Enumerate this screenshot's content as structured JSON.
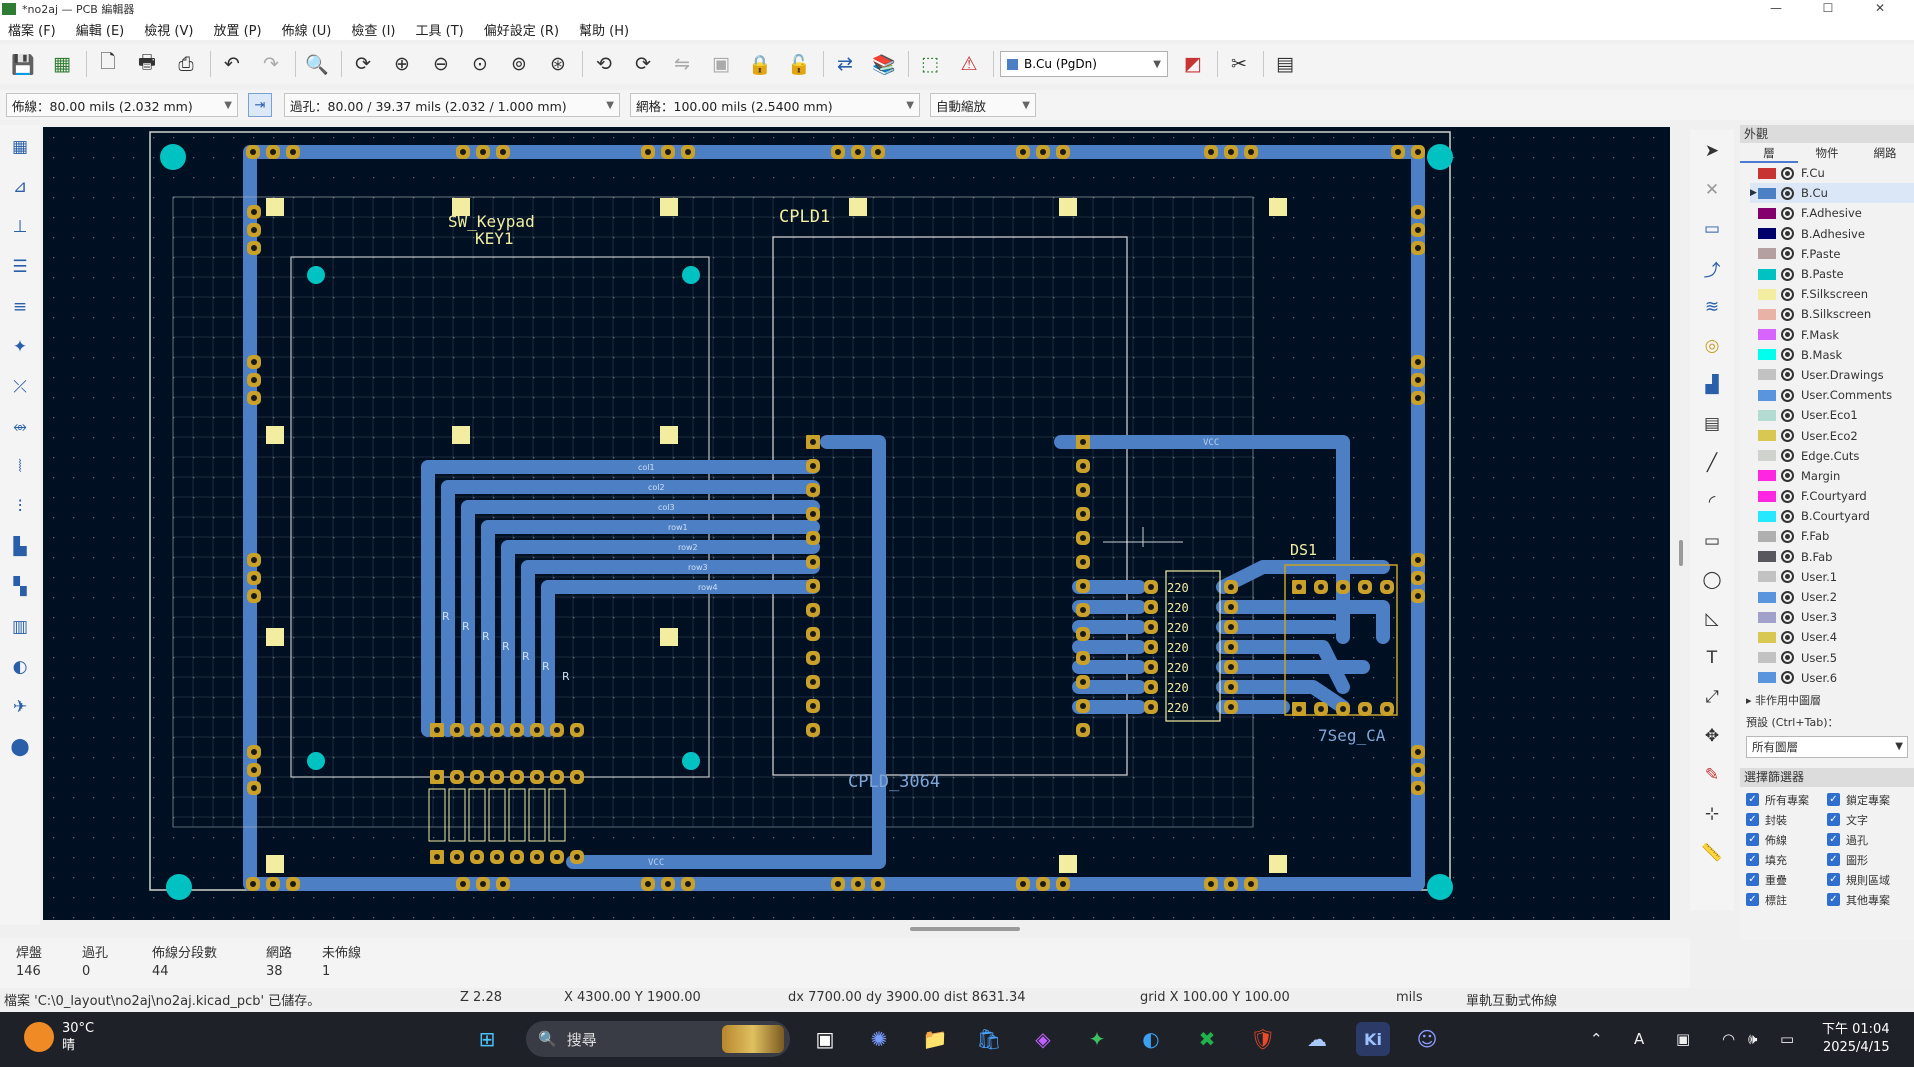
{
  "window": {
    "title": "*no2aj — PCB 編輯器",
    "controls": [
      "—",
      "☐",
      "✕"
    ]
  },
  "menu": [
    "檔案 (F)",
    "編輯 (E)",
    "檢視 (V)",
    "放置 (P)",
    "佈線 (U)",
    "檢查 (I)",
    "工具 (T)",
    "偏好設定 (R)",
    "幫助 (H)"
  ],
  "toolbar": {
    "layer_selector": "B.Cu (PgDn)",
    "icons": [
      "save-icon",
      "board-setup-icon",
      "page-setup-icon",
      "print-icon",
      "plot-icon",
      "undo-icon",
      "redo-icon",
      "find-icon",
      "refresh-icon",
      "zoom-in-icon",
      "zoom-out-icon",
      "zoom-fit-icon",
      "zoom-objects-icon",
      "zoom-selection-icon",
      "rotate-ccw-icon",
      "rotate-cw-icon",
      "flip-icon",
      "group-icon",
      "lock-icon",
      "unlock-icon",
      "netlist-icon",
      "footprint-editor-icon",
      "footprint-library-icon",
      "drc-icon",
      "layer-pair-icon",
      "scripting-icon",
      "python-icon"
    ]
  },
  "toolbar2": {
    "track": "佈線：80.00 mils (2.032 mm)",
    "via": "過孔：80.00 / 39.37 mils (2.032 / 1.000 mm)",
    "grid": "網格：100.00 mils (2.5400 mm)",
    "zoom": "自動縮放"
  },
  "board_labels": {
    "sw_keypad": "SW_Keypad",
    "key1": "KEY1",
    "cpld1": "CPLD1",
    "cpld_ref": "CPLD_3064",
    "ds1": "DS1",
    "seg_ref": "7Seg_CA",
    "vcc_top": "VCC",
    "vcc_bottom": "VCC",
    "resistor_value": "220",
    "net_labels": [
      "col1",
      "col2",
      "col3",
      "row1",
      "row2",
      "row3",
      "row4"
    ],
    "row_labels": [
      "R",
      "R",
      "R",
      "R",
      "R",
      "R",
      "R"
    ]
  },
  "panel": {
    "title": "外觀",
    "tabs": [
      "層",
      "物件",
      "網路"
    ],
    "layers": [
      {
        "name": "F.Cu",
        "color": "#c83434"
      },
      {
        "name": "B.Cu",
        "color": "#4d7fc4"
      },
      {
        "name": "F.Adhesive",
        "color": "#84006c"
      },
      {
        "name": "B.Adhesive",
        "color": "#00006c"
      },
      {
        "name": "F.Paste",
        "color": "#b4a0a0"
      },
      {
        "name": "B.Paste",
        "color": "#00c2c2"
      },
      {
        "name": "F.Silkscreen",
        "color": "#f2eda1"
      },
      {
        "name": "B.Silkscreen",
        "color": "#e8b2a7"
      },
      {
        "name": "F.Mask",
        "color": "#d864ff"
      },
      {
        "name": "B.Mask",
        "color": "#02ffee"
      },
      {
        "name": "User.Drawings",
        "color": "#c2c2c2"
      },
      {
        "name": "User.Comments",
        "color": "#5994dc"
      },
      {
        "name": "User.Eco1",
        "color": "#b4dbd2"
      },
      {
        "name": "User.Eco2",
        "color": "#d8c852"
      },
      {
        "name": "Edge.Cuts",
        "color": "#d0d2cd"
      },
      {
        "name": "Margin",
        "color": "#ff26e2"
      },
      {
        "name": "F.Courtyard",
        "color": "#ff26e2"
      },
      {
        "name": "B.Courtyard",
        "color": "#26e9ff"
      },
      {
        "name": "F.Fab",
        "color": "#afafaf"
      },
      {
        "name": "B.Fab",
        "color": "#58585e"
      },
      {
        "name": "User.1",
        "color": "#c2c2c2"
      },
      {
        "name": "User.2",
        "color": "#5994dc"
      },
      {
        "name": "User.3",
        "color": "#a0a0c8"
      },
      {
        "name": "User.4",
        "color": "#d8c852"
      },
      {
        "name": "User.5",
        "color": "#c2c2c2"
      },
      {
        "name": "User.6",
        "color": "#5994dc"
      }
    ],
    "non_active_label": "▸ 非作用中圖層",
    "preset_label": "預設 (Ctrl+Tab)：",
    "preset_value": "所有圖層",
    "filter_title": "選擇篩選器",
    "filters": [
      "所有專案",
      "鎖定專案",
      "封裝",
      "文字",
      "佈線",
      "過孔",
      "填充",
      "圖形",
      "重疊",
      "規則區域",
      "標註",
      "其他專案"
    ]
  },
  "stats": {
    "labels": [
      "焊盤",
      "過孔",
      "佈線分段數",
      "網路",
      "未佈線"
    ],
    "values": [
      "146",
      "0",
      "44",
      "38",
      "1"
    ]
  },
  "statusbar": {
    "file": "檔案 'C:\\0_layout\\no2aj\\no2aj.kicad_pcb' 已儲存。",
    "zoom": "Z 2.28",
    "xy": "X 4300.00  Y 1900.00",
    "delta": "dx 7700.00  dy 3900.00  dist 8631.34",
    "grid": "grid X 100.00  Y 100.00",
    "units": "mils",
    "mode": "單軌互動式佈線"
  },
  "taskbar": {
    "weather_temp": "30°C",
    "weather_desc": "晴",
    "search_placeholder": "搜尋",
    "time": "下午 01:04",
    "date": "2025/4/15",
    "ime": "A"
  },
  "colors": {
    "canvas_bg": "#001023",
    "copper_bottom": "#4d7fc4",
    "pad": "#c8a02a",
    "board_edge": "#d0d2cd",
    "accent": "#2e6fd0"
  }
}
